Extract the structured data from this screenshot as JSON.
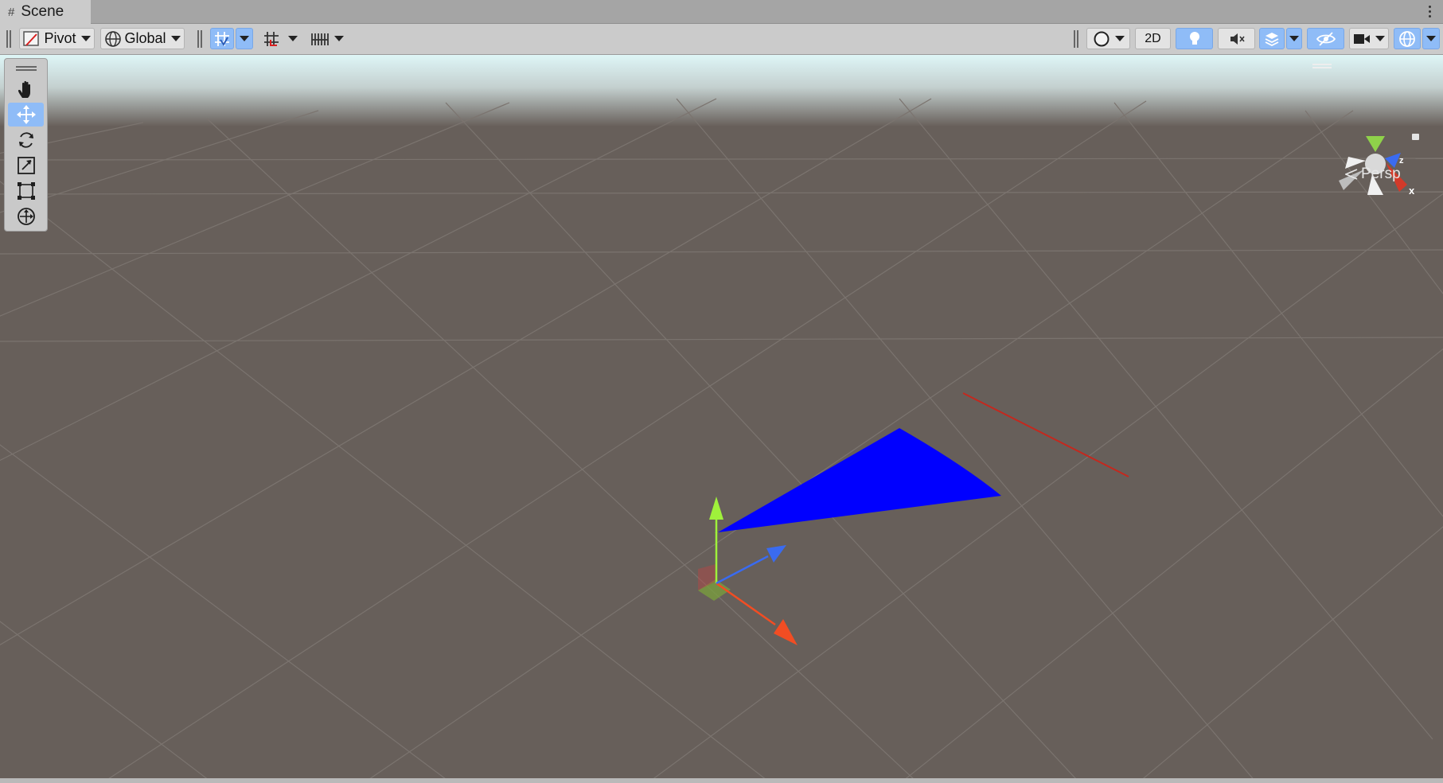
{
  "window": {
    "tab_title": "Scene"
  },
  "toolbar": {
    "pivot_label": "Pivot",
    "global_label": "Global",
    "two_d_label": "2D"
  },
  "viewport": {
    "projection_label": "Persp",
    "gizmo_axis_x": "x",
    "gizmo_axis_z": "z"
  },
  "colors": {
    "selection_blue": "#8fbcf7",
    "ground": "#675f5a",
    "mesh": "#0000ff",
    "axis_x": "#f24d23",
    "axis_y": "#9ff13b",
    "axis_z": "#3a6bf0"
  },
  "icons": {
    "tools": [
      "hand-icon",
      "move-icon",
      "rotate-icon",
      "scale-icon",
      "rect-icon",
      "transform-icon"
    ]
  }
}
